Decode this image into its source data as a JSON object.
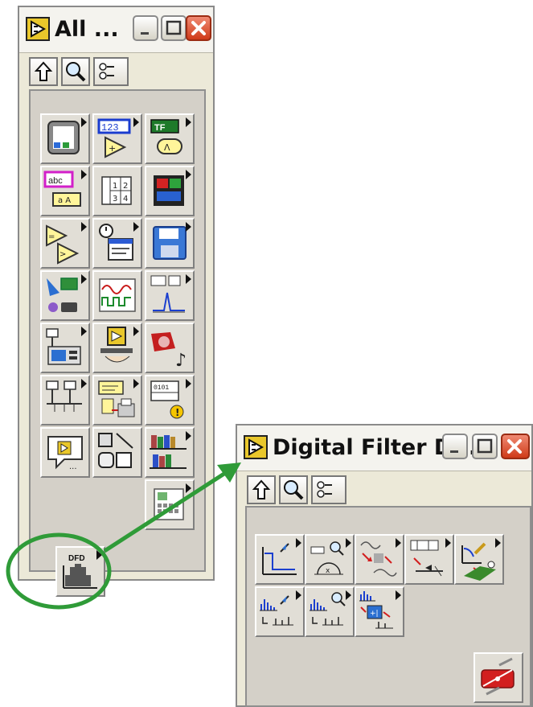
{
  "all_palette": {
    "title": "All ...",
    "dfd_tile_label": "DFD"
  },
  "dfd_palette": {
    "title": "Digital Filter D..."
  },
  "colors": {
    "highlight_circle": "#2f9b38",
    "arrow": "#2f9b38",
    "close_button": "#d94a2a"
  },
  "icons": {
    "up": "up-arrow-icon",
    "search": "magnifier-icon",
    "options": "view-options-icon"
  }
}
